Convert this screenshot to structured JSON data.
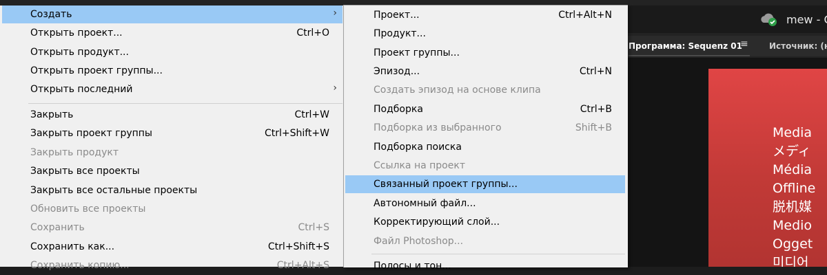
{
  "app": {
    "title": "mew - C",
    "program_tab": "Программа: Sequenz 01",
    "source_tab": "Источник: (не",
    "offline_lines": [
      "Media",
      "メディ",
      "Média",
      "Offline",
      "脱机媒",
      "Medio",
      "Ogget",
      "미디어"
    ]
  },
  "menu": {
    "items": [
      {
        "label": "Создать",
        "shortcut": "",
        "disabled": false,
        "highlighted": true,
        "submenu": true
      },
      {
        "label": "Открыть проект...",
        "shortcut": "Ctrl+O",
        "disabled": false
      },
      {
        "label": "Открыть продукт...",
        "shortcut": "",
        "disabled": false
      },
      {
        "label": "Открыть проект группы...",
        "shortcut": "",
        "disabled": false
      },
      {
        "label": "Открыть последний",
        "shortcut": "",
        "disabled": false,
        "submenu": true
      },
      {
        "label": "Закрыть",
        "shortcut": "Ctrl+W",
        "disabled": false
      },
      {
        "label": "Закрыть проект группы",
        "shortcut": "Ctrl+Shift+W",
        "disabled": false
      },
      {
        "label": "Закрыть продукт",
        "shortcut": "",
        "disabled": true
      },
      {
        "label": "Закрыть все проекты",
        "shortcut": "",
        "disabled": false
      },
      {
        "label": "Закрыть все остальные проекты",
        "shortcut": "",
        "disabled": false
      },
      {
        "label": "Обновить все проекты",
        "shortcut": "",
        "disabled": true
      },
      {
        "label": "Сохранить",
        "shortcut": "Ctrl+S",
        "disabled": true
      },
      {
        "label": "Сохранить как...",
        "shortcut": "Ctrl+Shift+S",
        "disabled": false
      },
      {
        "label": "Сохранить копию...",
        "shortcut": "Ctrl+Alt+S",
        "disabled": true
      }
    ],
    "submenu_arrow": "›"
  },
  "submenu": {
    "items": [
      {
        "label": "Проект...",
        "shortcut": "Ctrl+Alt+N",
        "disabled": false
      },
      {
        "label": "Продукт...",
        "shortcut": "",
        "disabled": false
      },
      {
        "label": "Проект группы...",
        "shortcut": "",
        "disabled": false
      },
      {
        "label": "Эпизод...",
        "shortcut": "Ctrl+N",
        "disabled": false
      },
      {
        "label": "Создать эпизод на основе клипа",
        "shortcut": "",
        "disabled": true
      },
      {
        "label": "Подборка",
        "shortcut": "Ctrl+B",
        "disabled": false
      },
      {
        "label": "Подборка из выбранного",
        "shortcut": "Shift+B",
        "disabled": true
      },
      {
        "label": "Подборка поиска",
        "shortcut": "",
        "disabled": false
      },
      {
        "label": "Ссылка на проект",
        "shortcut": "",
        "disabled": true
      },
      {
        "label": "Связанный проект группы...",
        "shortcut": "",
        "disabled": false,
        "highlighted": true
      },
      {
        "label": "Автономный файл...",
        "shortcut": "",
        "disabled": false
      },
      {
        "label": "Корректирующий слой...",
        "shortcut": "",
        "disabled": false
      },
      {
        "label": "Файл Photoshop...",
        "shortcut": "",
        "disabled": true
      },
      {
        "label": "Полосы и тон...",
        "shortcut": "",
        "disabled": false
      }
    ]
  },
  "colors": {
    "highlight": "#99c9f5",
    "disabled_text": "#8a8a8a",
    "offline_red": "#d9413f"
  }
}
